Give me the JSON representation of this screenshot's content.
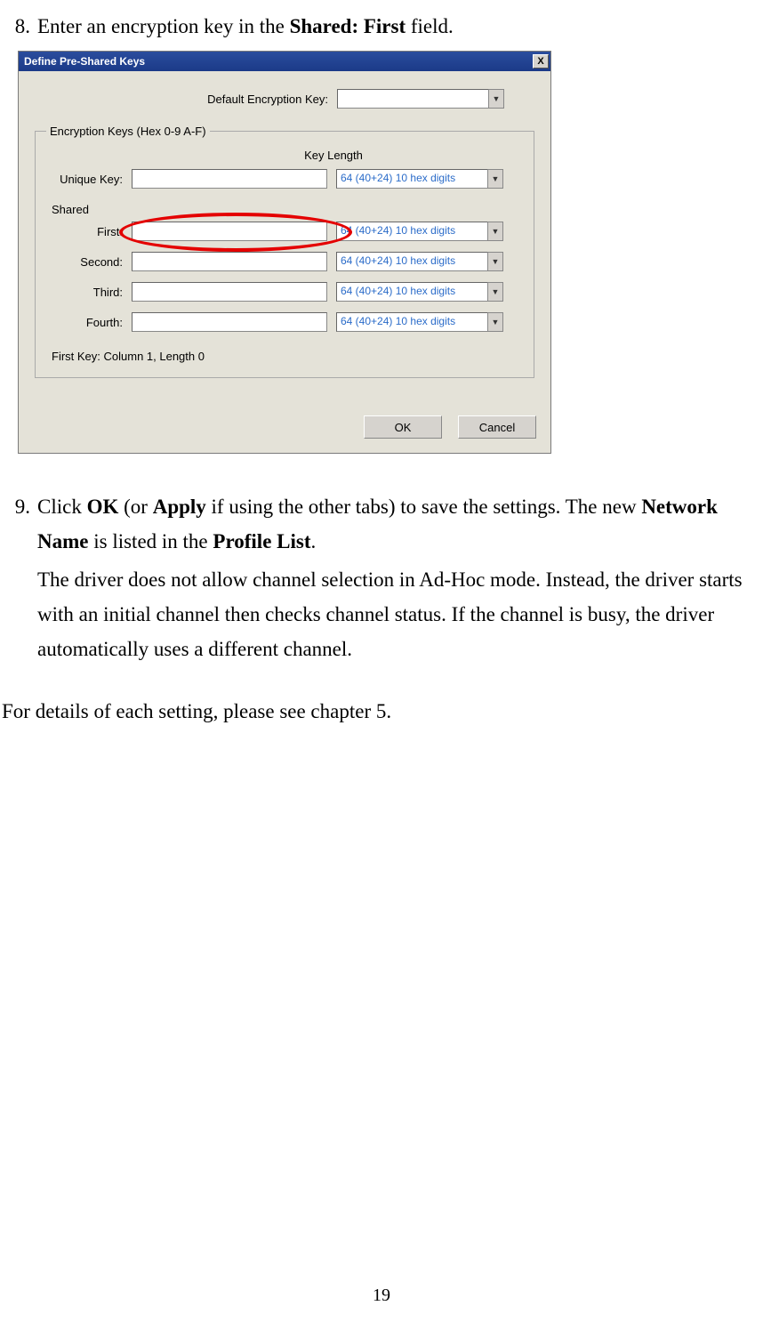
{
  "step8": {
    "num": "8.",
    "text_a": "Enter an encryption key in the ",
    "bold": "Shared: First",
    "text_b": " field."
  },
  "dialog": {
    "title": "Define Pre-Shared Keys",
    "close": "X",
    "default_label": "Default Encryption Key:",
    "default_value": "",
    "fieldset_legend": "Encryption Keys (Hex 0-9 A-F)",
    "keylen_header": "Key Length",
    "unique_label": "Unique Key:",
    "unique_value": "",
    "shared_label": "Shared",
    "rows": {
      "first": {
        "label": "First:",
        "value": "",
        "dd": "64  (40+24)  10 hex digits"
      },
      "second": {
        "label": "Second:",
        "value": "",
        "dd": "64  (40+24)  10 hex digits"
      },
      "third": {
        "label": "Third:",
        "value": "",
        "dd": "64  (40+24)  10 hex digits"
      },
      "fourth": {
        "label": "Fourth:",
        "value": "",
        "dd": "64  (40+24)  10 hex digits"
      }
    },
    "unique_dd": "64  (40+24)  10 hex digits",
    "status": "First Key: Column 1,  Length 0",
    "ok": "OK",
    "cancel": "Cancel"
  },
  "step9": {
    "num": "9.",
    "a": "Click ",
    "ok": "OK",
    "b": " (or ",
    "apply": "Apply",
    "c": " if using the other tabs) to save the settings. The new ",
    "nn": "Network Name",
    "d": " is listed in the ",
    "pl": "Profile List",
    "e": ".",
    "p2": "The driver does not allow channel selection in Ad-Hoc mode. Instead, the driver starts with an initial channel then checks channel status. If the channel is busy, the driver automatically uses a different channel."
  },
  "footer": "For details of each setting, please see chapter 5.",
  "page": "19"
}
